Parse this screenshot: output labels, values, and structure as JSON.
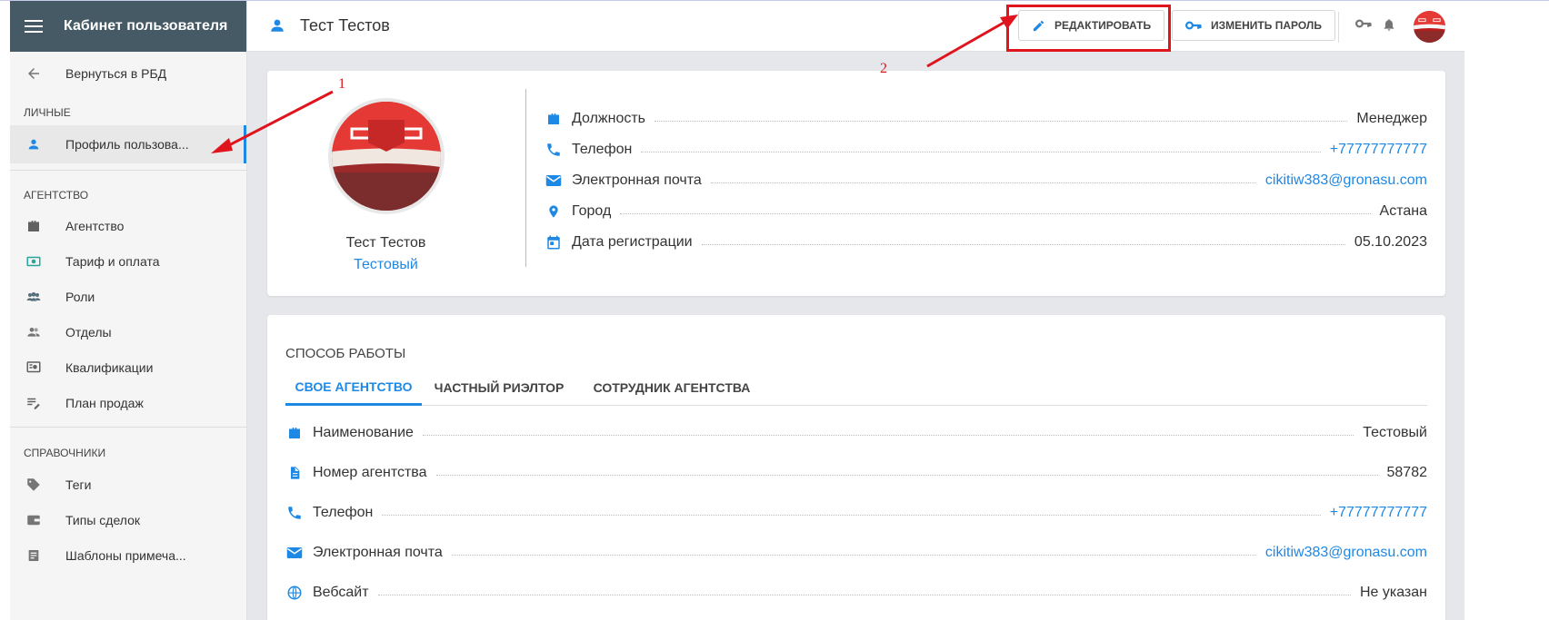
{
  "sidebar": {
    "title": "Кабинет пользователя",
    "back": "Вернуться в РБД",
    "sections": {
      "personal": "ЛИЧНЫЕ",
      "agency": "АГЕНТСТВО",
      "refs": "СПРАВОЧНИКИ"
    },
    "items": {
      "profile": "Профиль пользова...",
      "agency": "Агентство",
      "tariff": "Тариф и оплата",
      "roles": "Роли",
      "departments": "Отделы",
      "qualifications": "Квалификации",
      "sales_plan": "План продаж",
      "tags": "Теги",
      "deal_types": "Типы сделок",
      "note_templates": "Шаблоны примеча..."
    }
  },
  "topbar": {
    "user_name": "Тест Тестов",
    "edit_label": "РЕДАКТИРОВАТЬ",
    "change_password_label": "ИЗМЕНИТЬ ПАРОЛЬ"
  },
  "profile": {
    "name": "Тест Тестов",
    "role": "Тестовый",
    "fields": [
      {
        "label": "Должность",
        "value": "Менеджер"
      },
      {
        "label": "Телефон",
        "value": "+77777777777"
      },
      {
        "label": "Электронная почта",
        "value": "cikitiw383@gronasu.com"
      },
      {
        "label": "Город",
        "value": "Астана"
      },
      {
        "label": "Дата регистрации",
        "value": "05.10.2023"
      }
    ]
  },
  "work": {
    "title": "СПОСОБ РАБОТЫ",
    "tabs": [
      "СВОЕ АГЕНТСТВО",
      "ЧАСТНЫЙ РИЭЛТОР",
      "СОТРУДНИК АГЕНТСТВА"
    ],
    "fields": [
      {
        "label": "Наименование",
        "value": "Тестовый"
      },
      {
        "label": "Номер агентства",
        "value": "58782"
      },
      {
        "label": "Телефон",
        "value": "+77777777777"
      },
      {
        "label": "Электронная почта",
        "value": "cikitiw383@gronasu.com"
      },
      {
        "label": "Вебсайт",
        "value": "Не указан"
      }
    ]
  },
  "annotations": {
    "one": "1",
    "two": "2"
  },
  "colors": {
    "accent": "#1e88e5",
    "sidebar_header": "#455a64",
    "annotation": "#e0141c"
  }
}
